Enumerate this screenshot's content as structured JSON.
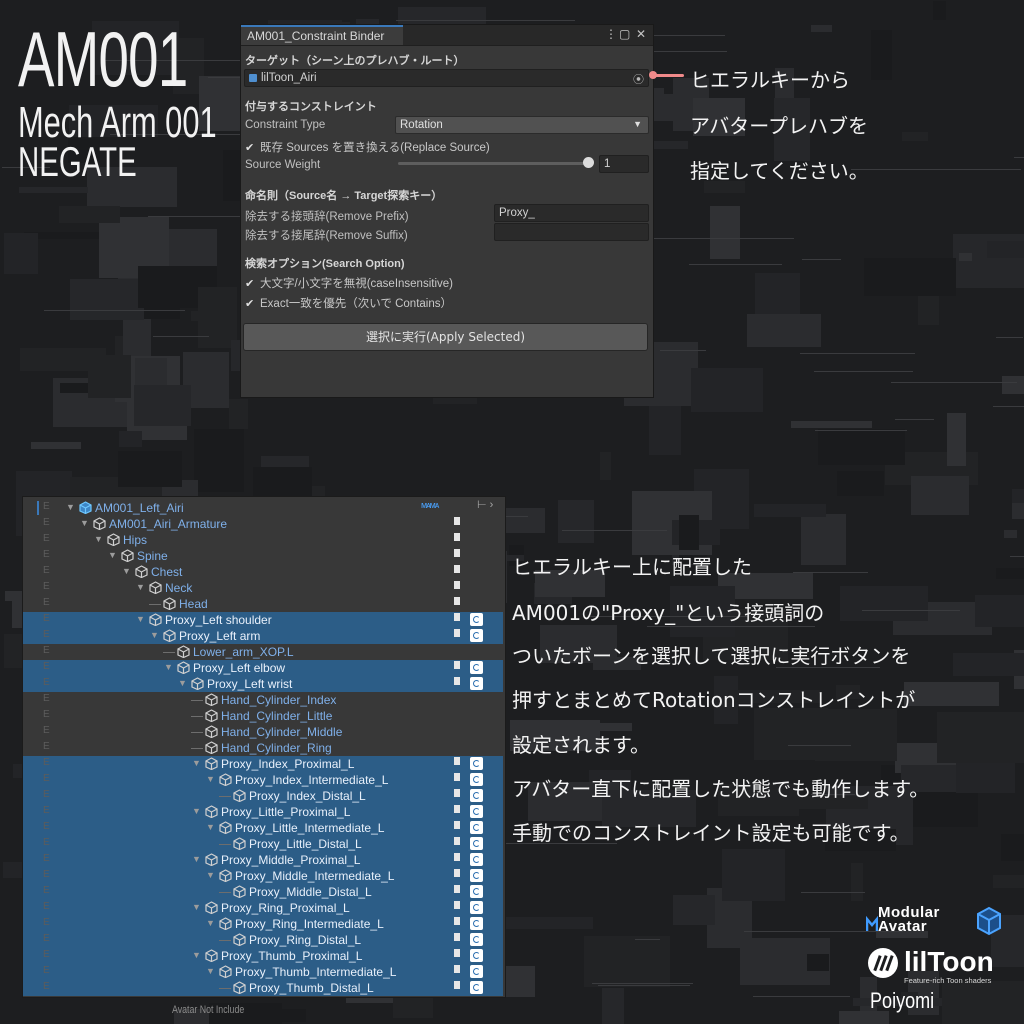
{
  "title": {
    "main": "AM001",
    "sub": "Mech Arm 001",
    "sub2": "NEGATE"
  },
  "window": {
    "tab": "AM001_Constraint Binder",
    "controls": [
      "⋮",
      "▢",
      "✕"
    ],
    "target_section": "ターゲット（シーン上のプレハブ・ルート）",
    "target_value": "lilToon_Airi",
    "constraint_section": "付与するコンストレイント",
    "constraint_type_label": "Constraint Type",
    "constraint_type_value": "Rotation",
    "replace_source_label": "既存 Sources を置き換える(Replace Source)",
    "replace_source_checked": true,
    "source_weight_label": "Source Weight",
    "source_weight_value": "1",
    "naming_section": "命名則（Source名 → Target探索キー）",
    "remove_prefix_label": "除去する接頭辞(Remove Prefix)",
    "remove_prefix_value": "Proxy_",
    "remove_suffix_label": "除去する接尾辞(Remove Suffix)",
    "remove_suffix_value": "",
    "search_section": "検索オプション(Search Option)",
    "case_insensitive_label": "大文字/小文字を無視(caseInsensitive)",
    "exact_match_label": "Exact一致を優先（次いで Contains）",
    "apply_button": "選択に実行(Apply Selected)"
  },
  "caption_top": [
    "ヒエラルキーから",
    "アバタープレハブを",
    "指定してください。"
  ],
  "caption_bottom": [
    "ヒエラルキー上に配置した",
    "AM001の\"Proxy_\"という接頭詞の",
    "ついたボーンを選択して選択に実行ボタンを",
    "押すとまとめてRotationコンストレイントが",
    "設定されます。",
    "アバター直下に配置した状態でも動作します。",
    "手動でのコンストレイント設定も可能です。"
  ],
  "hierarchy": [
    {
      "name": "AM001_Left_Airi",
      "depth": 0,
      "selected": false,
      "prefab_root": true
    },
    {
      "name": "AM001_Airi_Armature",
      "depth": 1,
      "selected": false
    },
    {
      "name": "Hips",
      "depth": 2,
      "selected": false
    },
    {
      "name": "Spine",
      "depth": 3,
      "selected": false
    },
    {
      "name": "Chest",
      "depth": 4,
      "selected": false
    },
    {
      "name": "Neck",
      "depth": 5,
      "selected": false
    },
    {
      "name": "Head",
      "depth": 6,
      "selected": false
    },
    {
      "name": "Proxy_Left shoulder",
      "depth": 5,
      "selected": true
    },
    {
      "name": "Proxy_Left arm",
      "depth": 6,
      "selected": true
    },
    {
      "name": "Lower_arm_XOP.L",
      "depth": 7,
      "selected": false
    },
    {
      "name": "Proxy_Left elbow",
      "depth": 7,
      "selected": true
    },
    {
      "name": "Proxy_Left wrist",
      "depth": 8,
      "selected": true
    },
    {
      "name": "Hand_Cylinder_Index",
      "depth": 9,
      "selected": false
    },
    {
      "name": "Hand_Cylinder_Little",
      "depth": 9,
      "selected": false
    },
    {
      "name": "Hand_Cylinder_Middle",
      "depth": 9,
      "selected": false
    },
    {
      "name": "Hand_Cylinder_Ring",
      "depth": 9,
      "selected": false
    },
    {
      "name": "Proxy_Index_Proximal_L",
      "depth": 9,
      "selected": true
    },
    {
      "name": "Proxy_Index_Intermediate_L",
      "depth": 10,
      "selected": true
    },
    {
      "name": "Proxy_Index_Distal_L",
      "depth": 11,
      "selected": true
    },
    {
      "name": "Proxy_Little_Proximal_L",
      "depth": 9,
      "selected": true
    },
    {
      "name": "Proxy_Little_Intermediate_L",
      "depth": 10,
      "selected": true
    },
    {
      "name": "Proxy_Little_Distal_L",
      "depth": 11,
      "selected": true
    },
    {
      "name": "Proxy_Middle_Proximal_L",
      "depth": 9,
      "selected": true
    },
    {
      "name": "Proxy_Middle_Intermediate_L",
      "depth": 10,
      "selected": true
    },
    {
      "name": "Proxy_Middle_Distal_L",
      "depth": 11,
      "selected": true
    },
    {
      "name": "Proxy_Ring_Proximal_L",
      "depth": 9,
      "selected": true
    },
    {
      "name": "Proxy_Ring_Intermediate_L",
      "depth": 10,
      "selected": true
    },
    {
      "name": "Proxy_Ring_Distal_L",
      "depth": 11,
      "selected": true
    },
    {
      "name": "Proxy_Thumb_Proximal_L",
      "depth": 9,
      "selected": true
    },
    {
      "name": "Proxy_Thumb_Intermediate_L",
      "depth": 10,
      "selected": true
    },
    {
      "name": "Proxy_Thumb_Distal_L",
      "depth": 11,
      "selected": true
    }
  ],
  "hierarchy_row_letter": "E",
  "avatar_note": "Avatar Not Include",
  "logos": {
    "modular_avatar_line1": "Modular",
    "modular_avatar_line2": "Avatar",
    "liltoon_name": "lilToon",
    "liltoon_tagline": "Feature-rich Toon shaders",
    "poiyomi": "Poiyomi"
  },
  "colors": {
    "accent_blue": "#3a79bb",
    "selection": "#2c5d87",
    "connector": "#f08a8a",
    "name_blue": "#7fb0ea"
  }
}
